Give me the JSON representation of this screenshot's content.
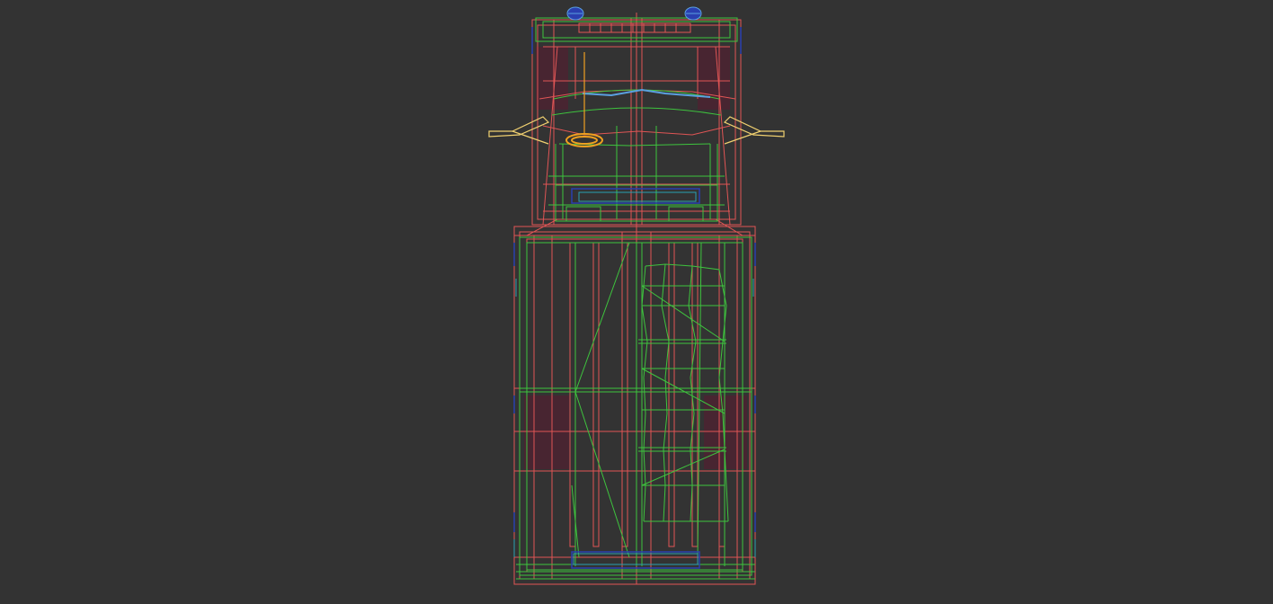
{
  "viewport": {
    "background": "#333333",
    "subject": "wireframe-truck-top-view",
    "colors": {
      "red": "#e05555",
      "red_dim": "#b84a5a",
      "green": "#3ec43e",
      "blue": "#2a3fb0",
      "light_blue": "#5aa0e0",
      "cyan": "#2aa0b0",
      "orange": "#f0a020",
      "yellow": "#f0d070",
      "maroon": "#5a1a30"
    }
  }
}
